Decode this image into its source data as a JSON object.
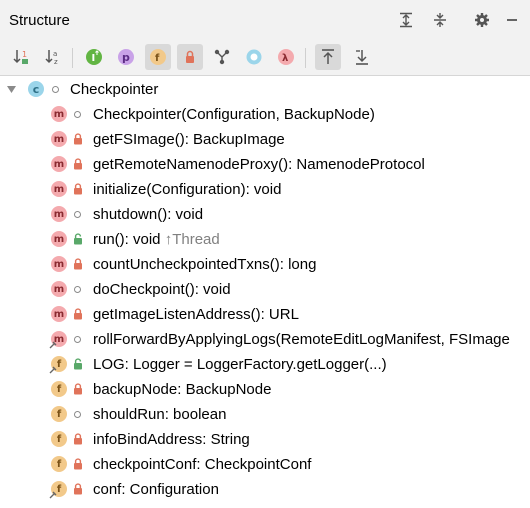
{
  "panel": {
    "title": "Structure"
  },
  "header_icons": [
    "expand-all-icon",
    "collapse-all-icon",
    "gear-icon",
    "minimize-icon"
  ],
  "toolbar_icons": [
    "sort-by-visibility-icon",
    "sort-alphabetically-icon",
    "show-inherited-icon",
    "show-properties-icon",
    "show-fields-icon",
    "show-non-public-icon",
    "show-anonymous-icon",
    "show-lambdas-icon",
    "lambda-icon",
    "autoscroll-to-source-icon",
    "autoscroll-from-source-icon"
  ],
  "colors": {
    "method_badge": "#f4aaae",
    "field_badge": "#f2c98a",
    "class_badge": "#9bd5ea",
    "lock": "#e0735a",
    "unlock": "#59a869",
    "muted": "#808080"
  },
  "tree": {
    "root": {
      "label": "Checkpointer",
      "kind": "class"
    },
    "items": [
      {
        "kind": "m",
        "vis": "package",
        "text": "Checkpointer(Configuration, BackupNode)",
        "suffix": ""
      },
      {
        "kind": "m",
        "vis": "private",
        "text": "getFSImage(): BackupImage",
        "suffix": ""
      },
      {
        "kind": "m",
        "vis": "private",
        "text": "getRemoteNamenodeProxy(): NamenodeProtocol",
        "suffix": ""
      },
      {
        "kind": "m",
        "vis": "private",
        "text": "initialize(Configuration): void",
        "suffix": ""
      },
      {
        "kind": "m",
        "vis": "package",
        "text": "shutdown(): void",
        "suffix": ""
      },
      {
        "kind": "m",
        "vis": "public",
        "text": "run(): void ",
        "suffix": "↑Thread"
      },
      {
        "kind": "m",
        "vis": "private",
        "text": "countUncheckpointedTxns(): long",
        "suffix": ""
      },
      {
        "kind": "m",
        "vis": "package",
        "text": "doCheckpoint(): void",
        "suffix": ""
      },
      {
        "kind": "m",
        "vis": "private",
        "text": "getImageListenAddress(): URL",
        "suffix": ""
      },
      {
        "kind": "m",
        "vis": "package",
        "static": true,
        "text": "rollForwardByApplyingLogs(RemoteEditLogManifest, FSImage",
        "suffix": ""
      },
      {
        "kind": "f",
        "vis": "public",
        "static": true,
        "text": "LOG: Logger = LoggerFactory.getLogger(...)",
        "suffix": ""
      },
      {
        "kind": "f",
        "vis": "private",
        "text": "backupNode: BackupNode",
        "suffix": ""
      },
      {
        "kind": "f",
        "vis": "package",
        "text": "shouldRun: boolean",
        "suffix": ""
      },
      {
        "kind": "f",
        "vis": "private",
        "text": "infoBindAddress: String",
        "suffix": ""
      },
      {
        "kind": "f",
        "vis": "private",
        "text": "checkpointConf: CheckpointConf",
        "suffix": ""
      },
      {
        "kind": "f",
        "vis": "private",
        "static": true,
        "text": "conf: Configuration",
        "suffix": ""
      }
    ]
  }
}
